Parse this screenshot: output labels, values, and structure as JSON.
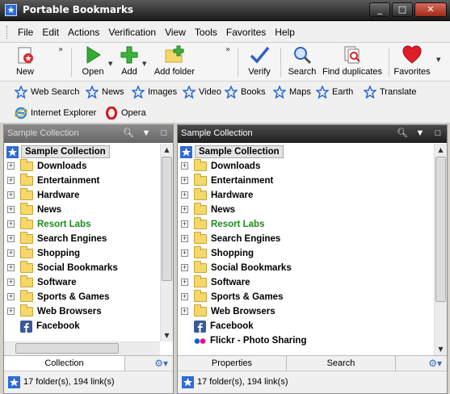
{
  "window": {
    "title": "Portable Bookmarks",
    "buttons": [
      "_",
      "□",
      "✕"
    ]
  },
  "menu": [
    "File",
    "Edit",
    "Actions",
    "Verification",
    "View",
    "Tools",
    "Favorites",
    "Help"
  ],
  "toolbar": {
    "new": "New",
    "open": "Open",
    "add": "Add",
    "add_folder": "Add folder",
    "verify": "Verify",
    "search": "Search",
    "find_duplicates": "Find duplicates",
    "favorites": "Favorites",
    "overflow": "»"
  },
  "links": [
    "Web Search",
    "News",
    "Images",
    "Video",
    "Books",
    "Maps",
    "Earth",
    "Translate",
    "Internet Explorer",
    "Opera"
  ],
  "left_panel": {
    "title": "Sample Collection",
    "root": "Sample Collection",
    "items": [
      {
        "label": "Downloads",
        "kind": "folder"
      },
      {
        "label": "Entertainment",
        "kind": "folder"
      },
      {
        "label": "Hardware",
        "kind": "folder"
      },
      {
        "label": "News",
        "kind": "folder"
      },
      {
        "label": "Resort Labs",
        "kind": "folder",
        "green": true
      },
      {
        "label": "Search Engines",
        "kind": "folder"
      },
      {
        "label": "Shopping",
        "kind": "folder"
      },
      {
        "label": "Social Bookmarks",
        "kind": "folder"
      },
      {
        "label": "Software",
        "kind": "folder"
      },
      {
        "label": "Sports & Games",
        "kind": "folder"
      },
      {
        "label": "Web Browsers",
        "kind": "folder"
      },
      {
        "label": "Facebook",
        "kind": "facebook"
      }
    ],
    "tabs": [
      "Collection"
    ],
    "status": "17 folder(s), 194 link(s)"
  },
  "right_panel": {
    "title": "Sample Collection",
    "root": "Sample Collection",
    "items": [
      {
        "label": "Downloads",
        "kind": "folder"
      },
      {
        "label": "Entertainment",
        "kind": "folder"
      },
      {
        "label": "Hardware",
        "kind": "folder"
      },
      {
        "label": "News",
        "kind": "folder"
      },
      {
        "label": "Resort Labs",
        "kind": "folder",
        "green": true
      },
      {
        "label": "Search Engines",
        "kind": "folder"
      },
      {
        "label": "Shopping",
        "kind": "folder"
      },
      {
        "label": "Social Bookmarks",
        "kind": "folder"
      },
      {
        "label": "Software",
        "kind": "folder"
      },
      {
        "label": "Sports & Games",
        "kind": "folder"
      },
      {
        "label": "Web Browsers",
        "kind": "folder"
      },
      {
        "label": "Facebook",
        "kind": "facebook"
      },
      {
        "label": "Flickr - Photo Sharing",
        "kind": "flickr"
      }
    ],
    "tabs": [
      "Properties",
      "Search"
    ],
    "status": "17 folder(s), 194 link(s)"
  },
  "colors": {
    "accent": "#2e6bd6",
    "green_text": "#1e8a1e",
    "folder": "#f5d76a"
  }
}
